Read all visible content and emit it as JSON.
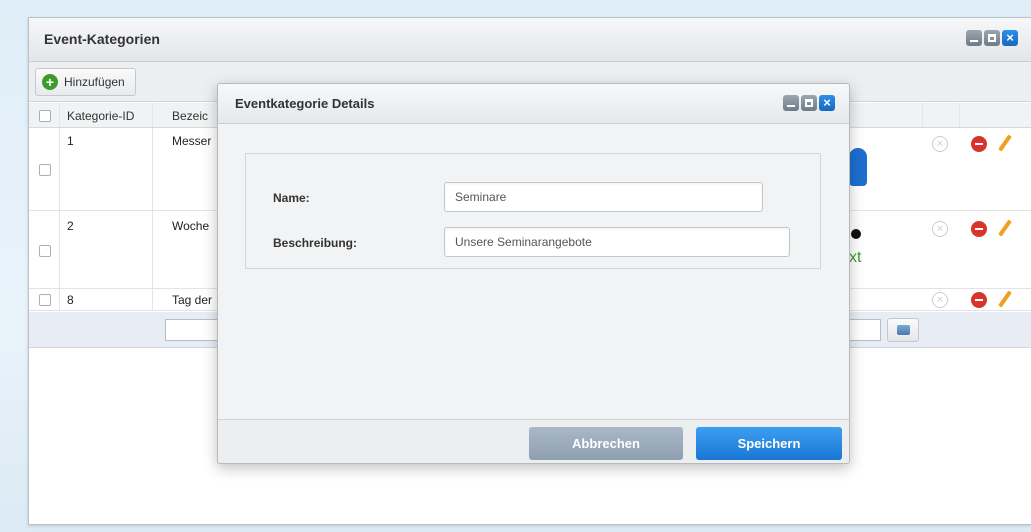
{
  "window": {
    "title": "Event-Kategorien"
  },
  "toolbar": {
    "add_label": "Hinzufügen"
  },
  "grid": {
    "columns": {
      "id": "Kategorie-ID",
      "name": "Bezeic"
    },
    "rows": [
      {
        "id": "1",
        "name": "Messer"
      },
      {
        "id": "2",
        "name": "Woche"
      },
      {
        "id": "8",
        "name": "Tag der"
      }
    ],
    "row2_image_text": "xt"
  },
  "modal": {
    "title": "Eventkategorie Details",
    "name_label": "Name:",
    "name_value": "Seminare",
    "desc_label": "Beschreibung:",
    "desc_value": "Unsere Seminarangebote",
    "cancel_label": "Abbrechen",
    "save_label": "Speichern"
  },
  "colors": {
    "accent": "#1b76d4",
    "add_green": "#3d9b2e",
    "delete_red": "#d9342b",
    "edit_orange": "#f0a020"
  },
  "icons": [
    "plus-icon",
    "minimize-icon",
    "maximize-icon",
    "close-icon",
    "cancel-icon",
    "delete-icon",
    "pencil-icon",
    "image-picker-icon"
  ]
}
